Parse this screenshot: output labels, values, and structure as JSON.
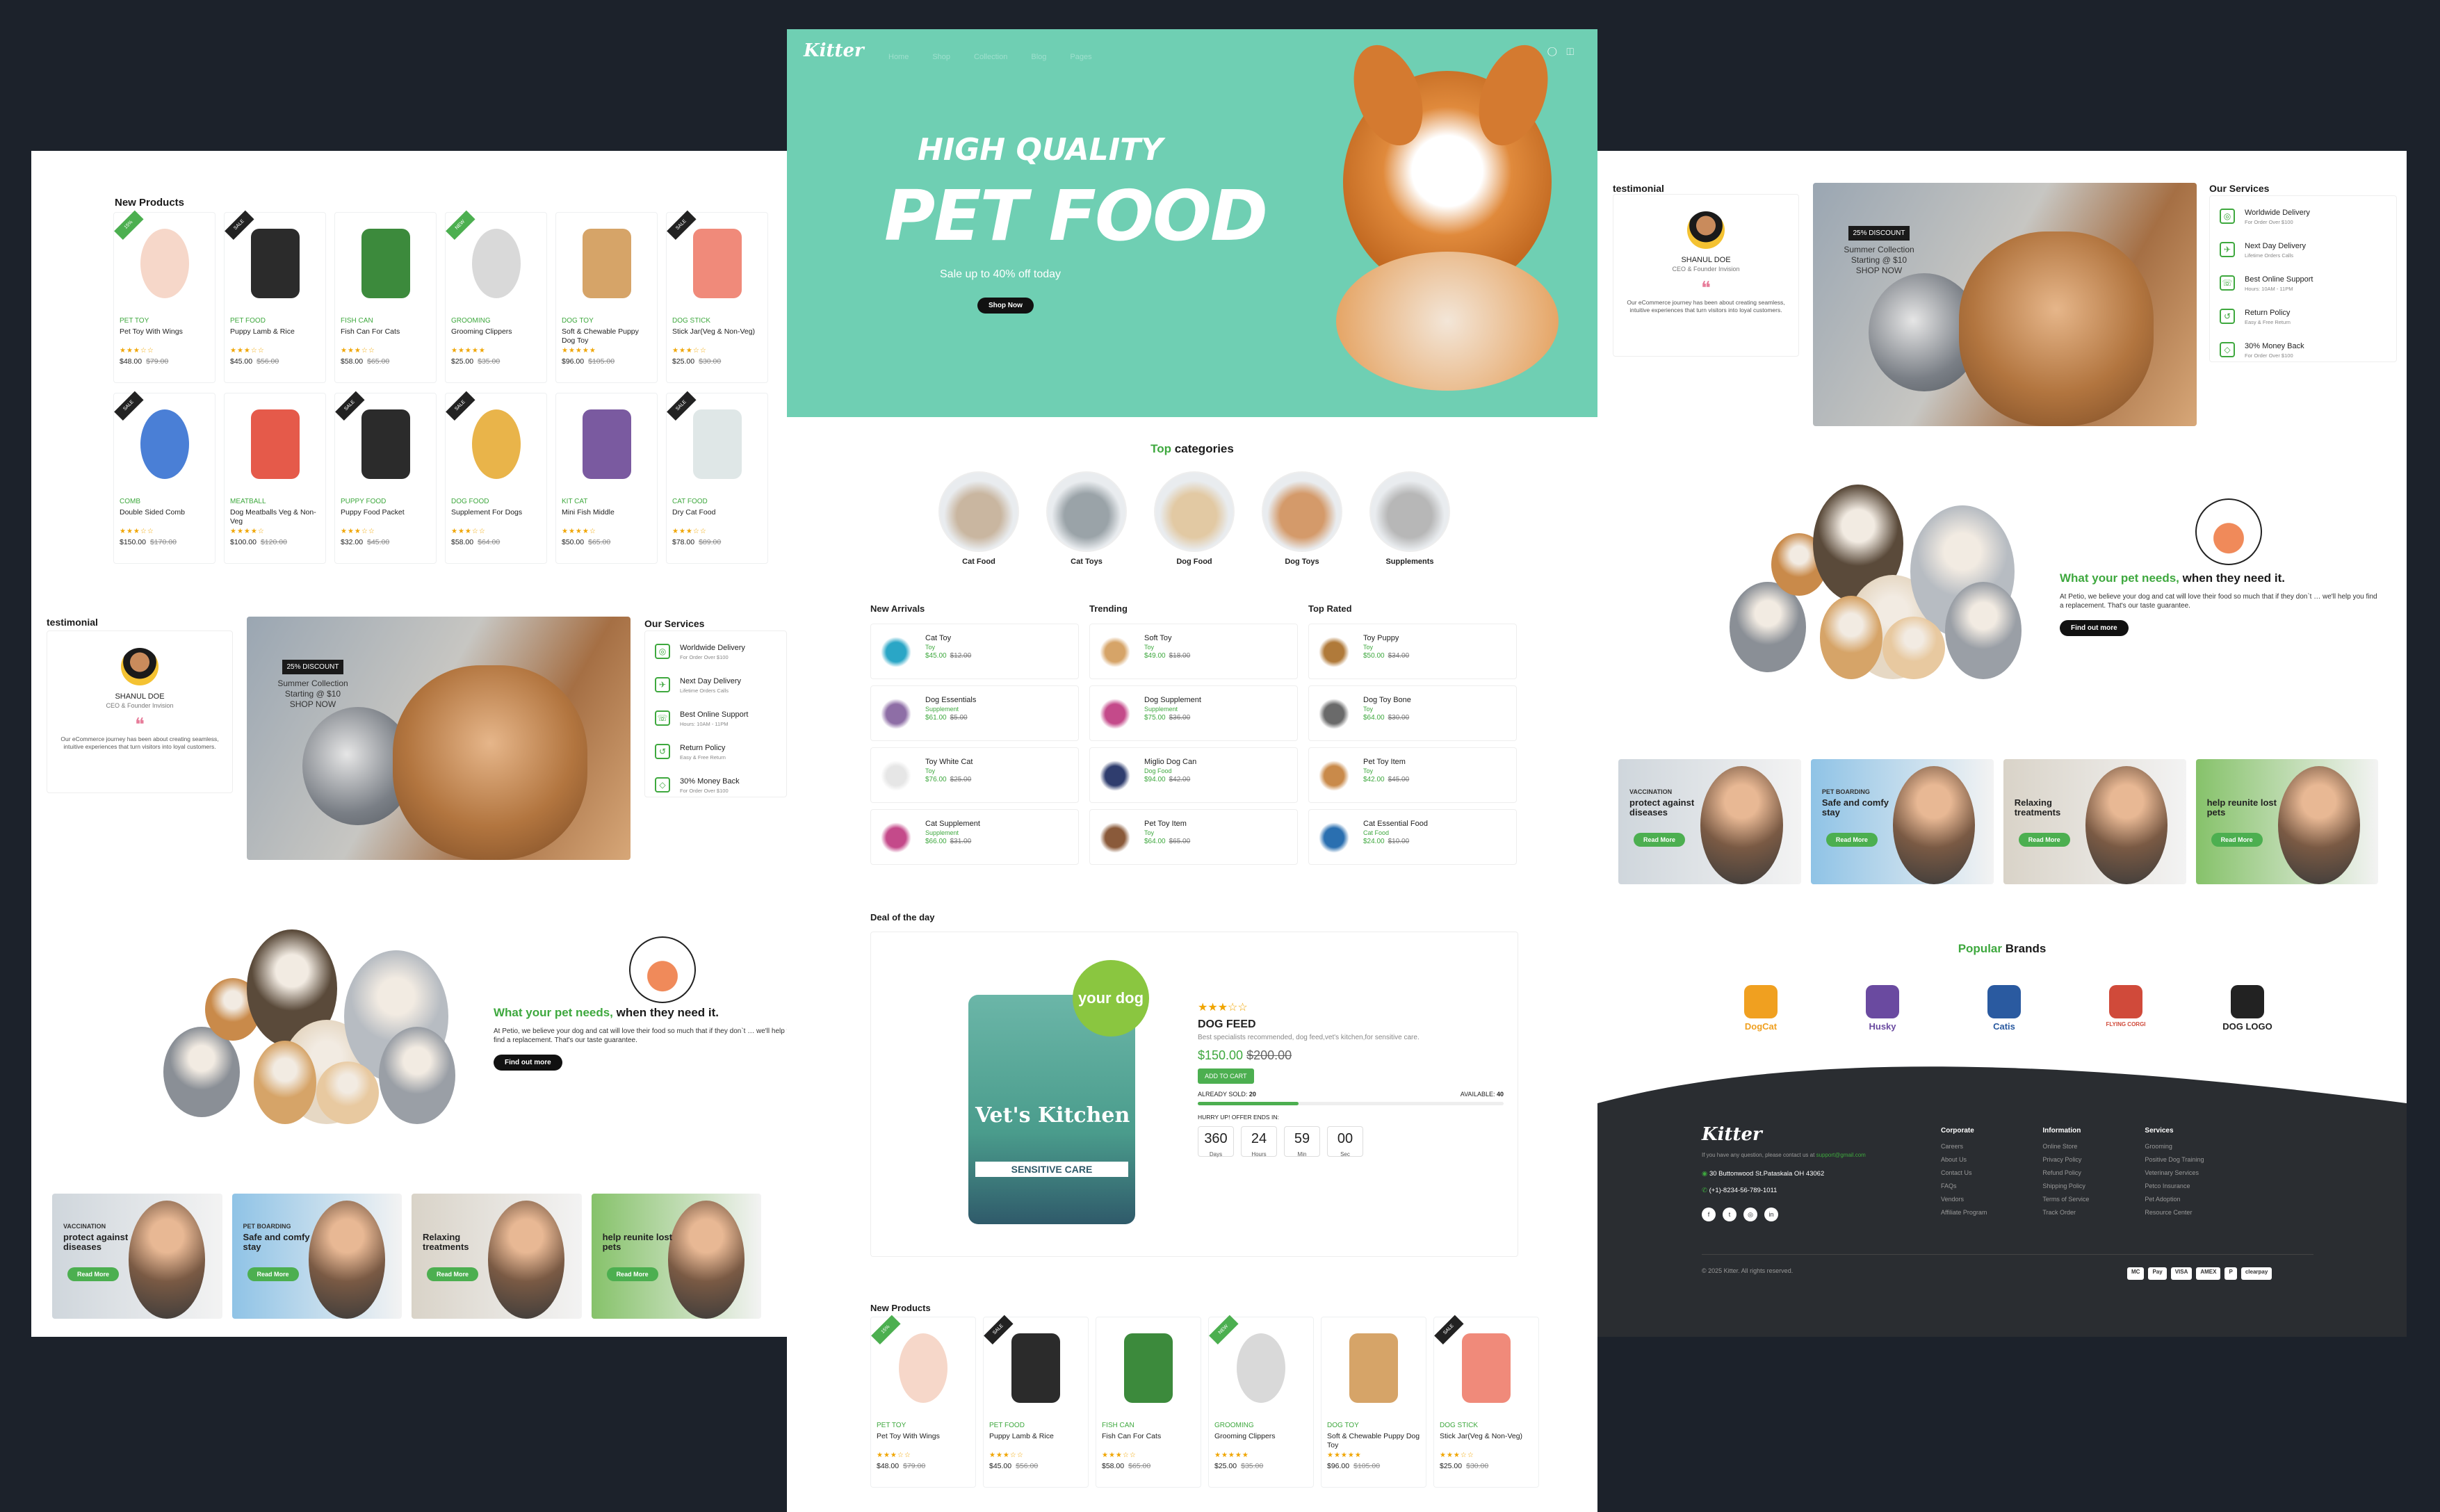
{
  "colors": {
    "accent": "#3ea83e",
    "hero": "#6fcfb3",
    "dark": "#1c222b",
    "footer": "#2a2d31",
    "star": "#f0a500"
  },
  "new_products": {
    "title": "New Products",
    "items": [
      {
        "cat": "PET TOY",
        "name": "Pet Toy With Wings",
        "stars": "★★★☆☆",
        "price": "$48.00",
        "old": "$79.00",
        "badge": "15%",
        "color": "#f6d7c9"
      },
      {
        "cat": "PET FOOD",
        "name": "Puppy Lamb & Rice",
        "stars": "★★★☆☆",
        "price": "$45.00",
        "old": "$56.00",
        "badge": "SALE",
        "color": "#2b2b2b"
      },
      {
        "cat": "FISH CAN",
        "name": "Fish Can For Cats",
        "stars": "★★★☆☆",
        "price": "$58.00",
        "old": "$65.00",
        "badge": "",
        "color": "#3c8a3c"
      },
      {
        "cat": "GROOMING",
        "name": "Grooming Clippers",
        "stars": "★★★★★",
        "price": "$25.00",
        "old": "$35.00",
        "badge": "NEW",
        "color": "#d9d9d9"
      },
      {
        "cat": "DOG TOY",
        "name": "Soft & Chewable Puppy Dog Toy",
        "stars": "★★★★★",
        "price": "$96.00",
        "old": "$105.00",
        "badge": "",
        "color": "#d6a468"
      },
      {
        "cat": "DOG STICK",
        "name": "Stick Jar(Veg & Non-Veg)",
        "stars": "★★★☆☆",
        "price": "$25.00",
        "old": "$30.00",
        "badge": "SALE",
        "color": "#f08a7a"
      },
      {
        "cat": "COMB",
        "name": "Double Sided Comb",
        "stars": "★★★☆☆",
        "price": "$150.00",
        "old": "$170.00",
        "badge": "SALE",
        "color": "#4a7fd6"
      },
      {
        "cat": "MEATBALL",
        "name": "Dog Meatballs Veg & Non-Veg",
        "stars": "★★★★☆",
        "price": "$100.00",
        "old": "$120.00",
        "badge": "",
        "color": "#e55a4a"
      },
      {
        "cat": "PUPPY FOOD",
        "name": "Puppy Food Packet",
        "stars": "★★★☆☆",
        "price": "$32.00",
        "old": "$45.00",
        "badge": "SALE",
        "color": "#2b2b2b"
      },
      {
        "cat": "DOG FOOD",
        "name": "Supplement For Dogs",
        "stars": "★★★☆☆",
        "price": "$58.00",
        "old": "$64.00",
        "badge": "SALE",
        "color": "#e9b44a"
      },
      {
        "cat": "KIT CAT",
        "name": "Mini Fish Middle",
        "stars": "★★★★☆",
        "price": "$50.00",
        "old": "$65.00",
        "badge": "",
        "color": "#7a5aa0"
      },
      {
        "cat": "CAT FOOD",
        "name": "Dry Cat Food",
        "stars": "★★★☆☆",
        "price": "$78.00",
        "old": "$89.00",
        "badge": "SALE",
        "color": "#dfe7e7"
      }
    ]
  },
  "testimonial": {
    "title": "testimonial",
    "name": "SHANUL DOE",
    "role": "CEO & Founder Invision",
    "quote": "❝",
    "body": "Our eCommerce journey has been about creating seamless, intuitive experiences that turn visitors into loyal customers."
  },
  "discount": {
    "badge": "25% DISCOUNT",
    "line1": "Summer Collection",
    "line2": "Starting @ $10",
    "line3": "SHOP NOW"
  },
  "services": {
    "title": "Our Services",
    "items": [
      {
        "name": "Worldwide Delivery",
        "sub": "For Order Over $100",
        "icon": "globe-icon",
        "glyph": "◎"
      },
      {
        "name": "Next Day Delivery",
        "sub": "Lifetime Orders Calls",
        "icon": "plane-icon",
        "glyph": "✈"
      },
      {
        "name": "Best Online Support",
        "sub": "Hours: 10AM - 11PM",
        "icon": "phone-icon",
        "glyph": "☏"
      },
      {
        "name": "Return Policy",
        "sub": "Easy & Free Return",
        "icon": "return-icon",
        "glyph": "↺"
      },
      {
        "name": "30% Money Back",
        "sub": "For Order Over $100",
        "icon": "tag-icon",
        "glyph": "◇"
      }
    ]
  },
  "needs": {
    "title_green": "What your pet needs,",
    "title_dark": " when they need it.",
    "body": "At Petio, we believe your dog and cat will love their food so much that if they don`t … we'll help you find a replacement. That's our taste guarantee.",
    "button": "Find out more"
  },
  "promos": [
    {
      "label": "VACCINATION",
      "title": "protect against diseases",
      "button": "Read More",
      "bg": "#cfd6dc"
    },
    {
      "label": "PET BOARDING",
      "title": "Safe and comfy stay",
      "button": "Read More",
      "bg": "#8fc3e6"
    },
    {
      "label": "",
      "title": "Relaxing treatments",
      "button": "Read More",
      "bg": "#d9d3c8"
    },
    {
      "label": "",
      "title": "help reunite lost pets",
      "button": "Read More",
      "bg": "#86c26a"
    }
  ],
  "header": {
    "logo": "Kitter",
    "nav": [
      "Home",
      "Shop",
      "Collection",
      "Blog",
      "Pages"
    ]
  },
  "hero": {
    "line1": "HIGH QUALITY",
    "line2": "PET FOOD",
    "sub": "Sale up to 40% off today",
    "button": "Shop Now"
  },
  "top_categories": {
    "title_green": "Top",
    "title_dark": " categories",
    "items": [
      {
        "label": "Cat Food",
        "color": "#c9b6a0"
      },
      {
        "label": "Cat Toys",
        "color": "#9aa3a8"
      },
      {
        "label": "Dog Food",
        "color": "#e2c9a3"
      },
      {
        "label": "Dog Toys",
        "color": "#d49a6a"
      },
      {
        "label": "Supplements",
        "color": "#b7b7b7"
      }
    ]
  },
  "lists": [
    {
      "title": "New Arrivals",
      "items": [
        {
          "name": "Cat Toy",
          "sub": "Toy",
          "price": "$45.00",
          "old": "$12.00",
          "color": "#2aa6c6"
        },
        {
          "name": "Dog Essentials",
          "sub": "Supplement",
          "price": "$61.00",
          "old": "$5.00",
          "color": "#8e6ea6"
        },
        {
          "name": "Toy White Cat",
          "sub": "Toy",
          "price": "$76.00",
          "old": "$25.00",
          "color": "#e6e6e6"
        },
        {
          "name": "Cat Supplement",
          "sub": "Supplement",
          "price": "$66.00",
          "old": "$31.00",
          "color": "#c44a8a"
        }
      ]
    },
    {
      "title": "Trending",
      "items": [
        {
          "name": "Soft Toy",
          "sub": "Toy",
          "price": "$49.00",
          "old": "$18.00",
          "color": "#d6a468"
        },
        {
          "name": "Dog Supplement",
          "sub": "Supplement",
          "price": "$75.00",
          "old": "$36.00",
          "color": "#c44a8a"
        },
        {
          "name": "Miglio Dog Can",
          "sub": "Dog Food",
          "price": "$94.00",
          "old": "$42.00",
          "color": "#2f3d6e"
        },
        {
          "name": "Pet Toy Item",
          "sub": "Toy",
          "price": "$64.00",
          "old": "$65.00",
          "color": "#8a5a3a"
        }
      ]
    },
    {
      "title": "Top Rated",
      "items": [
        {
          "name": "Toy Puppy",
          "sub": "Toy",
          "price": "$50.00",
          "old": "$34.00",
          "color": "#b07a3a"
        },
        {
          "name": "Dog Toy Bone",
          "sub": "Toy",
          "price": "$64.00",
          "old": "$30.00",
          "color": "#6a6a6a"
        },
        {
          "name": "Pet Toy Item",
          "sub": "Toy",
          "price": "$42.00",
          "old": "$45.00",
          "color": "#c98a4a"
        },
        {
          "name": "Cat Essential Food",
          "sub": "Cat Food",
          "price": "$24.00",
          "old": "$10.00",
          "color": "#2a6fb0"
        }
      ]
    }
  ],
  "deal": {
    "title": "Deal of the day",
    "stars": "★★★☆☆",
    "name": "DOG FEED",
    "desc": "Best specialists recommended, dog feed,vet's kitchen,for sensitive care.",
    "price": "$150.00",
    "old": "$200.00",
    "button": "ADD TO CART",
    "sold_label": "ALREADY SOLD:",
    "sold": "20",
    "avail_label": "AVAILABLE:",
    "avail": "40",
    "sold_fraction": 0.33,
    "hurry": "HURRY UP! OFFER ENDS IN:",
    "countdown": [
      {
        "v": "360",
        "l": "Days"
      },
      {
        "v": "24",
        "l": "Hours"
      },
      {
        "v": "59",
        "l": "Min"
      },
      {
        "v": "00",
        "l": "Sec"
      }
    ],
    "pack_title": "Vet's Kitchen",
    "pack_sub": "SENSITIVE CARE",
    "seal": "your dog"
  },
  "brands": {
    "title_green": "Popular",
    "title_dark": " Brands",
    "items": [
      {
        "name": "DogCat",
        "color": "#f0a020"
      },
      {
        "name": "Husky",
        "color": "#6a4aa0"
      },
      {
        "name": "Catis",
        "color": "#2a5aa0"
      },
      {
        "name": "FLYING CORGI",
        "color": "#d04a3a"
      },
      {
        "name": "DOG LOGO",
        "color": "#222"
      }
    ]
  },
  "footer": {
    "logo": "Kitter",
    "contact": "If you have any question, please contact us at",
    "email": "support@gmail.com",
    "address": "30 Buttonwood St.Pataskala OH 43062",
    "phone": "(+1)-8234-56-789-1011",
    "cols": [
      {
        "title": "Corporate",
        "links": [
          "Careers",
          "About Us",
          "Contact Us",
          "FAQs",
          "Vendors",
          "Affiliate Program"
        ]
      },
      {
        "title": "Information",
        "links": [
          "Online Store",
          "Privacy Policy",
          "Refund Policy",
          "Shipping Policy",
          "Terms of Service",
          "Track Order"
        ]
      },
      {
        "title": "Services",
        "links": [
          "Grooming",
          "Positive Dog Training",
          "Veterinary Services",
          "Petco Insurance",
          "Pet Adoption",
          "Resource Center"
        ]
      }
    ],
    "copyright": "© 2025 Kitter. All rights reserved.",
    "socials": [
      "f",
      "t",
      "◎",
      "in"
    ],
    "pay": [
      "MC",
      "Pay",
      "VISA",
      "AMEX",
      "P",
      "clearpay"
    ]
  }
}
